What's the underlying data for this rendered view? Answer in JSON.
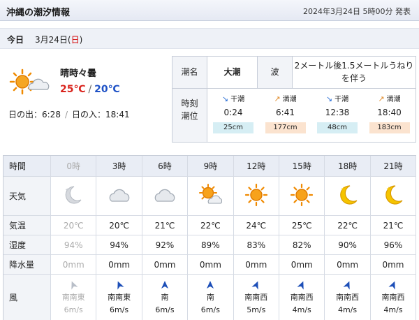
{
  "header": {
    "title": "沖縄の潮汐情報",
    "announced": "2024年3月24日 5時00分 発表"
  },
  "day": {
    "label": "今日",
    "date_prefix": "3月24日(",
    "weekday": "日",
    "date_suffix": ")"
  },
  "summary": {
    "weather_icon": "sun-cloud-icon",
    "weather_text": "晴時々曇",
    "temp_high": "25℃",
    "temp_sep": "/",
    "temp_low": "20℃",
    "sunrise_label": "日の出：6:28",
    "sunline_sep": "/",
    "sunset_label": "日の入：18:41"
  },
  "tide": {
    "name_label": "潮名",
    "name_value": "大潮",
    "wave_label": "波",
    "wave_value": "2メートル後1.5メートルうねりを伴う",
    "time_label_1": "時刻",
    "time_label_2": "潮位",
    "entries": [
      {
        "kind": "干潮",
        "type": "ebb",
        "arrow": "↘",
        "time": "0:24",
        "height": "25cm"
      },
      {
        "kind": "満潮",
        "type": "flood",
        "arrow": "↗",
        "time": "6:41",
        "height": "177cm"
      },
      {
        "kind": "干潮",
        "type": "ebb",
        "arrow": "↘",
        "time": "12:38",
        "height": "48cm"
      },
      {
        "kind": "満潮",
        "type": "flood",
        "arrow": "↗",
        "time": "18:40",
        "height": "183cm"
      }
    ]
  },
  "forecast": {
    "row_labels": {
      "time": "時間",
      "weather": "天気",
      "temp": "気温",
      "humidity": "湿度",
      "precip": "降水量",
      "wind": "風"
    },
    "hours": [
      {
        "time": "0時",
        "past": true,
        "icon": "moon-cloud-icon",
        "temp": "20℃",
        "humidity": "94%",
        "precip": "0mm",
        "wind_dir": "南南東",
        "wind_deg": 157.5,
        "wind_speed": "6m/s"
      },
      {
        "time": "3時",
        "past": false,
        "icon": "cloud-icon",
        "temp": "20℃",
        "humidity": "94%",
        "precip": "0mm",
        "wind_dir": "南南東",
        "wind_deg": 157.5,
        "wind_speed": "6m/s"
      },
      {
        "time": "6時",
        "past": false,
        "icon": "cloud-icon",
        "temp": "21℃",
        "humidity": "92%",
        "precip": "0mm",
        "wind_dir": "南",
        "wind_deg": 180,
        "wind_speed": "6m/s"
      },
      {
        "time": "9時",
        "past": false,
        "icon": "sun-cloud-icon",
        "temp": "22℃",
        "humidity": "89%",
        "precip": "0mm",
        "wind_dir": "南",
        "wind_deg": 180,
        "wind_speed": "6m/s"
      },
      {
        "time": "12時",
        "past": false,
        "icon": "sun-icon",
        "temp": "24℃",
        "humidity": "83%",
        "precip": "0mm",
        "wind_dir": "南南西",
        "wind_deg": 202.5,
        "wind_speed": "5m/s"
      },
      {
        "time": "15時",
        "past": false,
        "icon": "sun-icon",
        "temp": "25℃",
        "humidity": "82%",
        "precip": "0mm",
        "wind_dir": "南南西",
        "wind_deg": 202.5,
        "wind_speed": "4m/s"
      },
      {
        "time": "18時",
        "past": false,
        "icon": "moon-icon",
        "temp": "22℃",
        "humidity": "90%",
        "precip": "0mm",
        "wind_dir": "南南西",
        "wind_deg": 202.5,
        "wind_speed": "4m/s"
      },
      {
        "time": "21時",
        "past": false,
        "icon": "moon-icon",
        "temp": "21℃",
        "humidity": "96%",
        "precip": "0mm",
        "wind_dir": "南南西",
        "wind_deg": 202.5,
        "wind_speed": "4m/s"
      }
    ]
  }
}
